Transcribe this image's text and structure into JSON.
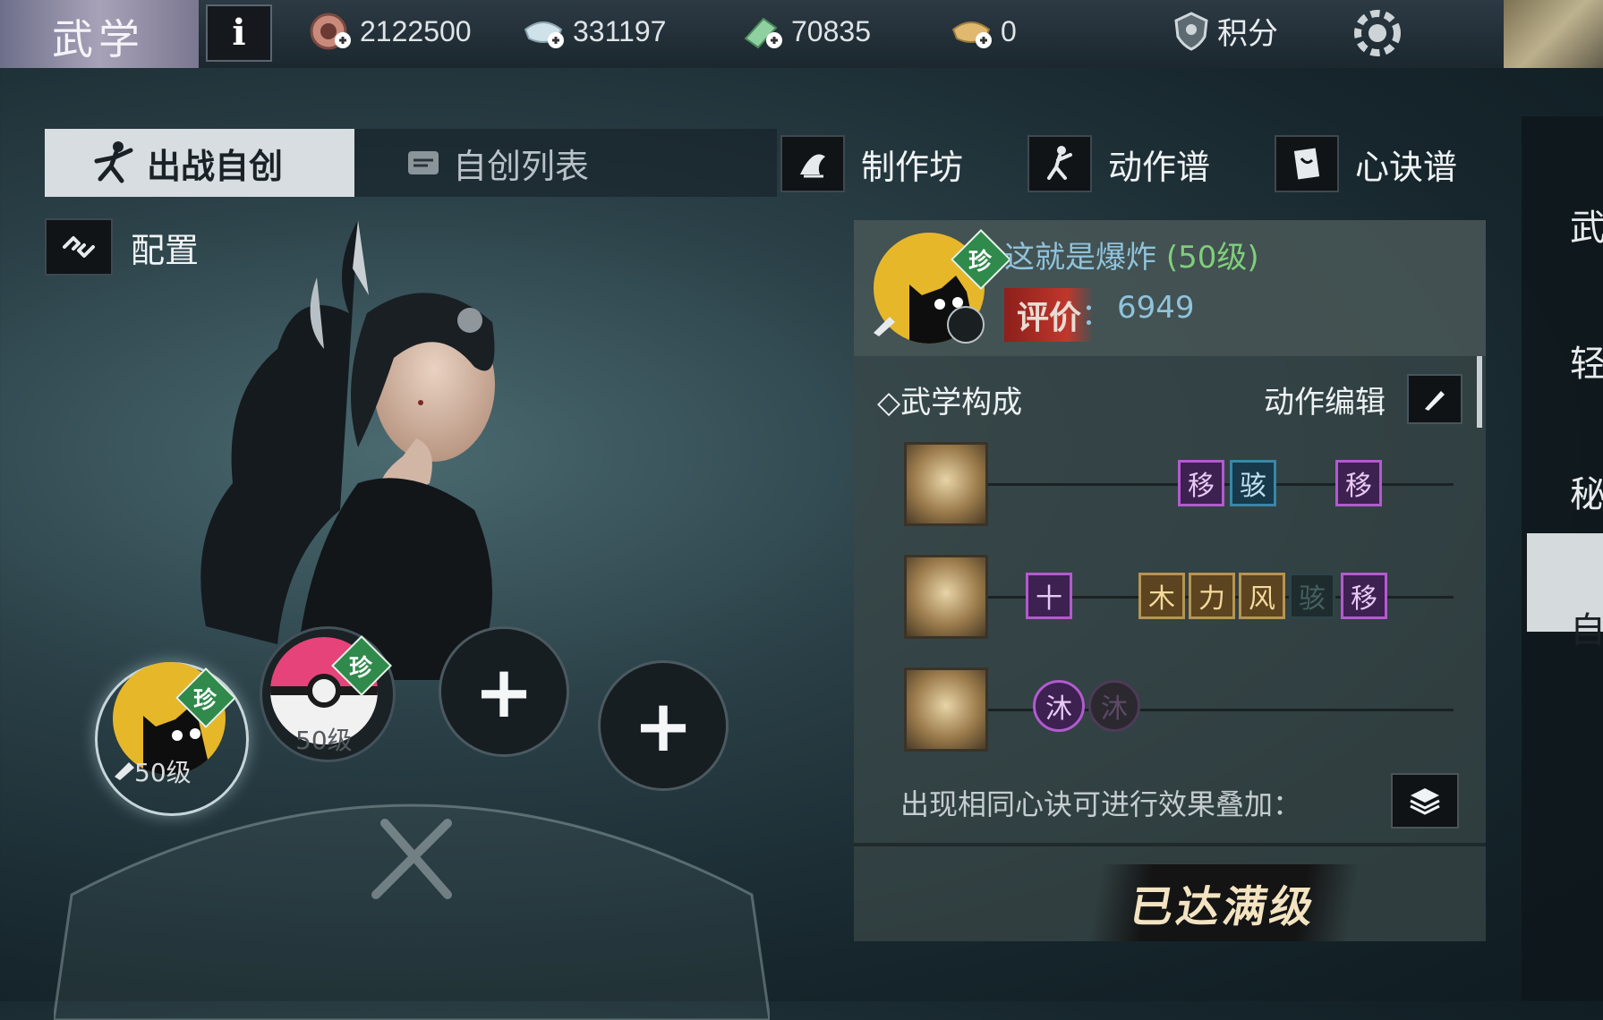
{
  "header": {
    "title": "武学",
    "info_label": "i",
    "currencies": [
      {
        "icon": "coin-icon",
        "value": "2122500"
      },
      {
        "icon": "silver-ingot-icon",
        "value": "331197"
      },
      {
        "icon": "jade-ticket-icon",
        "value": "70835"
      },
      {
        "icon": "gold-ingot-icon",
        "value": "0"
      }
    ],
    "points_label": "积分"
  },
  "tabs": {
    "active_label": "出战自创",
    "list_label": "自创列表"
  },
  "nav": {
    "workshop": "制作坊",
    "action_book": "动作谱",
    "mind_book": "心诀谱"
  },
  "config_label": "配置",
  "slots": {
    "slot1_level": "50级",
    "slot1_badge": "珍",
    "slot2_level": "50级",
    "slot2_badge": "珍",
    "add_symbol": "+"
  },
  "panel": {
    "badge": "珍",
    "skill_name": "这就是爆炸",
    "skill_level": "(50级)",
    "rating_label": "评价",
    "rating_colon": "：",
    "rating_value": "6949",
    "section_title": "◇武学构成",
    "edit_label": "动作编辑",
    "tracks": [
      {
        "tags": [
          "移",
          "骇",
          "移"
        ]
      },
      {
        "tags": [
          "十",
          "木",
          "力",
          "风",
          "骇",
          "移"
        ]
      },
      {
        "tags": [
          "沐",
          "沐"
        ]
      }
    ],
    "stack_text": "出现相同心诀可进行效果叠加：",
    "max_level": "已达满级"
  },
  "sidebar": {
    "items": [
      "武",
      "轻",
      "秘",
      "自"
    ]
  },
  "colors": {
    "accent_blue": "#8fc3dc",
    "level_green": "#7fcf7a",
    "rare_green": "#2f8a4b",
    "tag_purple": "#b35ad0",
    "tag_gold": "#b69452"
  }
}
